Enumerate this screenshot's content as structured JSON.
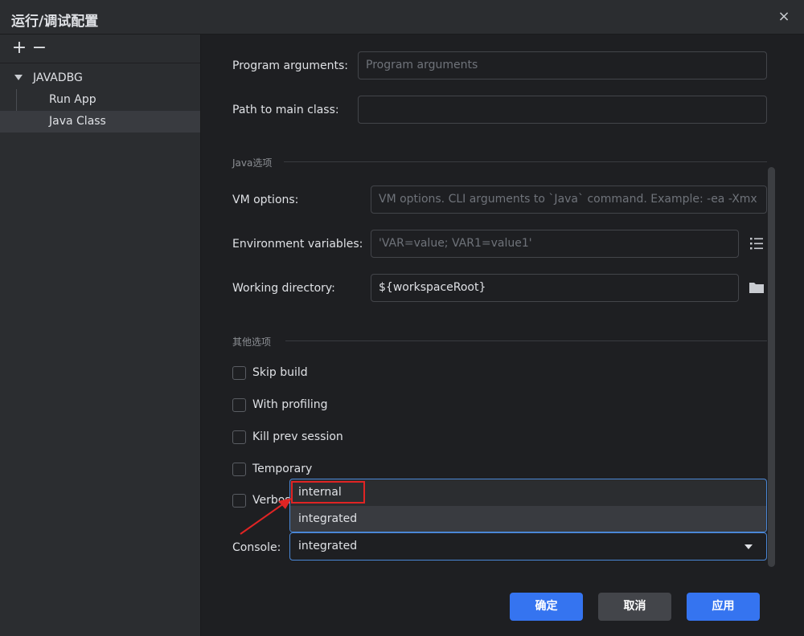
{
  "window": {
    "title": "运行/调试配置",
    "close_icon": "×"
  },
  "sidebar": {
    "add_icon": "+",
    "remove_icon": "−",
    "group": {
      "label": "JAVADBG"
    },
    "items": [
      {
        "label": "Run App",
        "selected": false
      },
      {
        "label": "Java Class",
        "selected": true
      }
    ]
  },
  "form": {
    "program_arguments": {
      "label": "Program arguments:",
      "value": "",
      "placeholder": "Program arguments"
    },
    "path_to_main_class": {
      "label": "Path to main class:",
      "value": ""
    },
    "java_section": {
      "title": "Java选项"
    },
    "vm_options": {
      "label": "VM options:",
      "value": "",
      "placeholder": "VM options. CLI arguments to `Java` command. Example: -ea -Xmx"
    },
    "environment_variables": {
      "label": "Environment variables:",
      "value": "",
      "placeholder": "'VAR=value; VAR1=value1'"
    },
    "working_directory": {
      "label": "Working directory:",
      "value": "${workspaceRoot}"
    },
    "other_section": {
      "title": "其他选项"
    },
    "checkboxes": [
      {
        "label": "Skip build",
        "checked": false
      },
      {
        "label": "With profiling",
        "checked": false
      },
      {
        "label": "Kill prev session",
        "checked": false
      },
      {
        "label": "Temporary",
        "checked": false
      },
      {
        "label": "Verbose",
        "checked": false
      }
    ],
    "console": {
      "label": "Console:",
      "selected": "integrated",
      "options": [
        "internal",
        "integrated"
      ]
    }
  },
  "buttons": {
    "ok": "确定",
    "cancel": "取消",
    "apply": "应用"
  },
  "colors": {
    "accent": "#3574f0",
    "annotation": "#e02424"
  }
}
